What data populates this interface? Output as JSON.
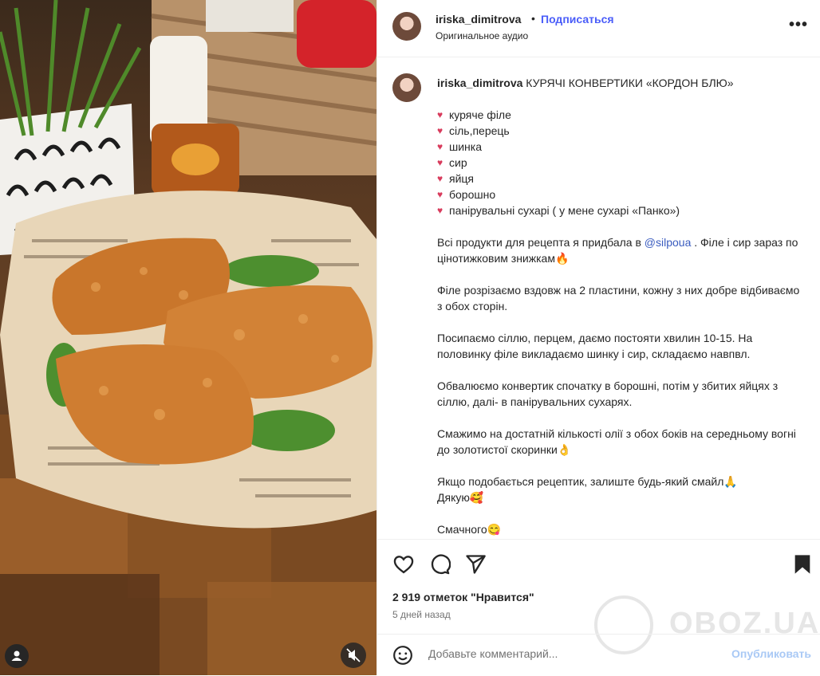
{
  "post": {
    "username": "iriska_dimitrova",
    "follow_label": "Подписаться",
    "separator": "•",
    "audio": "Оригинальное аудио",
    "more_label": "•••"
  },
  "caption": {
    "username": "iriska_dimitrova",
    "title": "КУРЯЧІ КОНВЕРТИКИ «КОРДОН БЛЮ»",
    "ingredients": [
      "куряче філе",
      "сіль,перець",
      "шинка",
      "сир",
      "яйця",
      "борошно",
      "панірувальні сухарі ( у мене сухарі «Панко»)"
    ],
    "bullet": "♥",
    "p1_before": "Всі продукти для рецепта я придбала в ",
    "p1_mention": "@silpoua",
    "p1_after": " . Філе і сир зараз по цінотижковим знижкам🔥",
    "p2": "Філе розрізаємо вздовж на 2 пластини, кожну з них добре відбиваємо з обох сторін.",
    "p3": "Посипаємо сіллю, перцем, даємо постояти хвилин 10-15. На половинку філе викладаємо шинку і сир, складаємо навпвл.",
    "p4": "Обвалюємо конвертик спочатку в борошні, потім у збитих яйцях з сіллю, далі- в панірувальних сухарях.",
    "p5": "Смажимо на достатній кількості олії з обох боків на середньому вогні до золотистої скоринки👌",
    "p6a": "Якщо подобається рецептик, залиште будь-який смайл🙏",
    "p6b": "Дякую🥰",
    "p7": "Смачного😋"
  },
  "stats": {
    "likes": "2 919 отметок \"Нравится\"",
    "date": "5 дней назад"
  },
  "comment": {
    "placeholder": "Добавьте комментарий...",
    "publish_label": "Опубликовать"
  },
  "watermark": "OBOZ.UA",
  "colors": {
    "follow": "#4a5df9",
    "publish_disabled": "#a9c9f5",
    "bullet_heart": "#d83b5c"
  }
}
